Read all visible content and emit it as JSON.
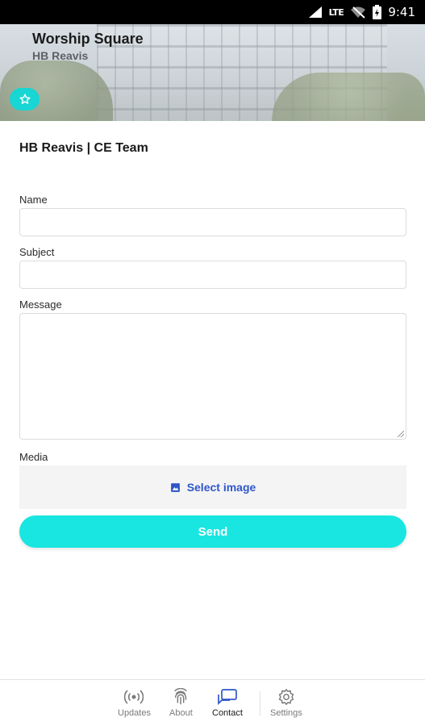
{
  "status_bar": {
    "network": "LTE",
    "time": "9:41"
  },
  "header": {
    "title": "Worship Square",
    "subtitle": "HB Reavis",
    "favorite_icon": "star-icon"
  },
  "form": {
    "team_title": "HB Reavis | CE Team",
    "name_label": "Name",
    "name_value": "",
    "subject_label": "Subject",
    "subject_value": "",
    "message_label": "Message",
    "message_value": "",
    "media_label": "Media",
    "select_image_label": "Select image",
    "send_label": "Send"
  },
  "colors": {
    "accent": "#19e6e1",
    "link": "#2f57c9",
    "active_nav": "#2f57c9"
  },
  "bottom_nav": {
    "items": [
      {
        "label": "Updates",
        "icon": "broadcast-icon"
      },
      {
        "label": "About",
        "icon": "fingerprint-icon"
      },
      {
        "label": "Contact",
        "icon": "chat-icon",
        "active": true
      },
      {
        "label": "Settings",
        "icon": "gear-icon"
      }
    ]
  }
}
